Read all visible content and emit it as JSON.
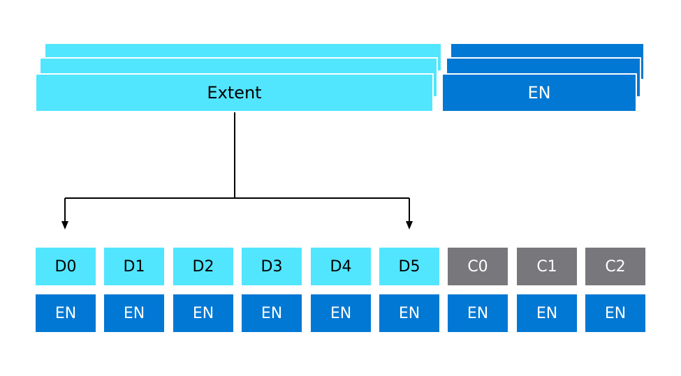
{
  "colors": {
    "extent": "#52e5fe",
    "en": "#0078d4",
    "data_cell": "#52e5fe",
    "parity_cell": "#78777b",
    "connector": "#000000",
    "dark_text": "#000000",
    "light_text": "#ffffff"
  },
  "top": {
    "extent_label": "Extent",
    "en_label": "EN"
  },
  "cells": [
    {
      "label": "D0",
      "kind": "data",
      "en": "EN"
    },
    {
      "label": "D1",
      "kind": "data",
      "en": "EN"
    },
    {
      "label": "D2",
      "kind": "data",
      "en": "EN"
    },
    {
      "label": "D3",
      "kind": "data",
      "en": "EN"
    },
    {
      "label": "D4",
      "kind": "data",
      "en": "EN"
    },
    {
      "label": "D5",
      "kind": "data",
      "en": "EN"
    },
    {
      "label": "C0",
      "kind": "parity",
      "en": "EN"
    },
    {
      "label": "C1",
      "kind": "parity",
      "en": "EN"
    },
    {
      "label": "C2",
      "kind": "parity",
      "en": "EN"
    }
  ]
}
